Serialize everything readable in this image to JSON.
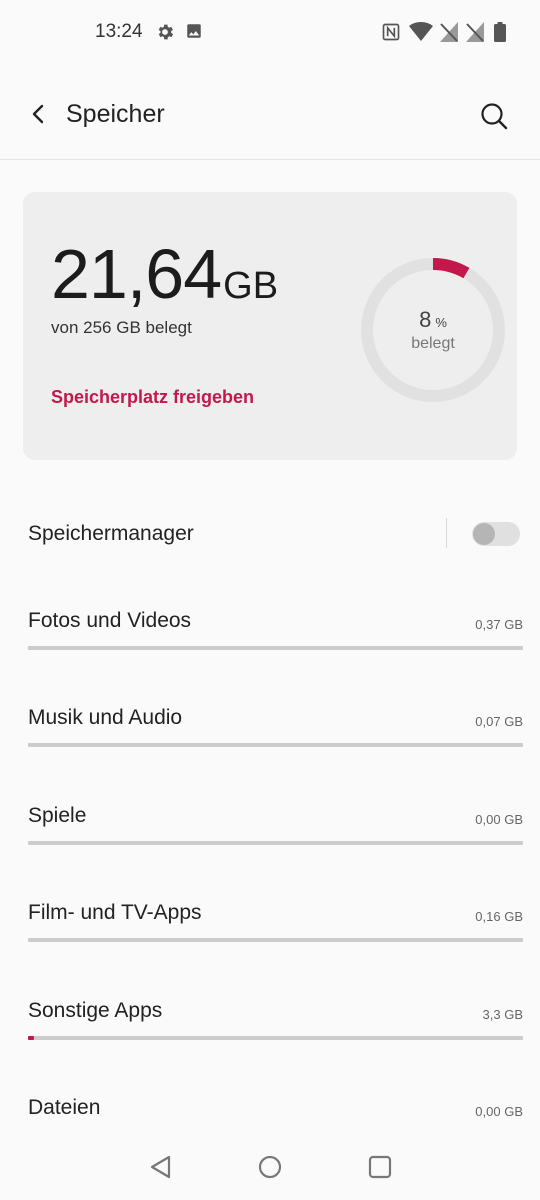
{
  "status_bar": {
    "time": "13:24",
    "left_icons": [
      "gear-icon",
      "image-icon"
    ],
    "right_icons": [
      "nfc-icon",
      "wifi-icon",
      "no-signal-icon",
      "no-signal-icon",
      "battery-icon"
    ]
  },
  "app_bar": {
    "title": "Speicher",
    "back_icon": "back-arrow-icon",
    "search_icon": "search-icon"
  },
  "summary": {
    "used_value": "21,64",
    "used_unit": "GB",
    "used_of": "von 256 GB belegt",
    "free_up_label": "Speicherplatz freigeben",
    "percent": "8",
    "percent_sign": "%",
    "percent_label": "belegt",
    "used_fraction": 0.0845,
    "accent_color": "#c2184b"
  },
  "manager": {
    "label": "Speichermanager",
    "enabled": false
  },
  "categories": [
    {
      "label": "Fotos und Videos",
      "size": "0,37 GB",
      "fraction": 0.0
    },
    {
      "label": "Musik und Audio",
      "size": "0,07 GB",
      "fraction": 0.0
    },
    {
      "label": "Spiele",
      "size": "0,00 GB",
      "fraction": 0.0
    },
    {
      "label": "Film- und TV-Apps",
      "size": "0,16 GB",
      "fraction": 0.0
    },
    {
      "label": "Sonstige Apps",
      "size": "3,3 GB",
      "fraction": 0.0129
    },
    {
      "label": "Dateien",
      "size": "0,00 GB",
      "fraction": 0.0
    }
  ],
  "nav_bar": {
    "icons": [
      "nav-back-icon",
      "nav-home-icon",
      "nav-recents-icon"
    ]
  }
}
